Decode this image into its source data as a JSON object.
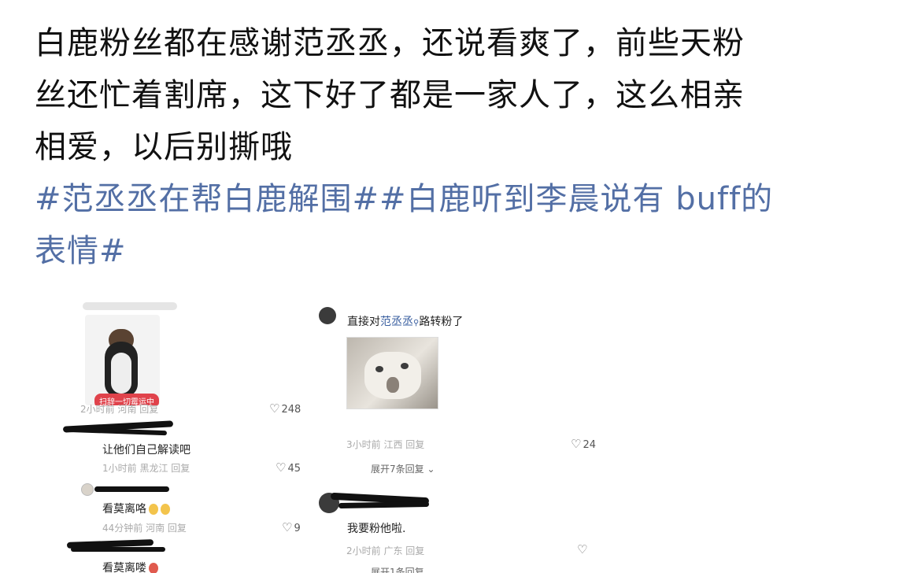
{
  "post": {
    "line1": "白鹿粉丝都在感谢范丞丞，还说看爽了，前些天粉",
    "line2": "丝还忙着割席，这下好了都是一家人了，这么相亲",
    "line3": "相爱，以后别撕哦",
    "hashtag1": "#范丞丞在帮白鹿解围##白鹿听到李晨说有 buff的",
    "hashtag2": "表情#"
  },
  "left_shot": {
    "comment1_meta": "2小时前  河南    回复",
    "comment1_likes": "248",
    "sticker_tag": "扫辞一切霉运中",
    "comment2_text": "让他们自己解读吧",
    "comment2_meta": "1小时前  黑龙江    回复",
    "comment2_likes": "45",
    "comment3_text": "看莫离咯",
    "comment3_meta": "44分钟前  河南    回复",
    "comment3_likes": "9",
    "comment4_text": "看莫离喽"
  },
  "right_shot": {
    "comment1_prefix": "直接对",
    "comment1_link": "范丞丞",
    "comment1_suffix": "路转粉了",
    "comment1_meta": "3小时前  江西    回复",
    "comment1_likes": "24",
    "expand_replies": "展开7条回复 ⌄",
    "comment2_text": "我要粉他啦.",
    "comment2_meta": "2小时前  广东    回复"
  },
  "icons": {
    "heart": "heart-outline-icon",
    "search": "search-icon"
  },
  "colors": {
    "hashtag": "#536fa5",
    "text": "#111111",
    "meta": "#aaaaaa",
    "sticker_tag": "#e0424b"
  }
}
